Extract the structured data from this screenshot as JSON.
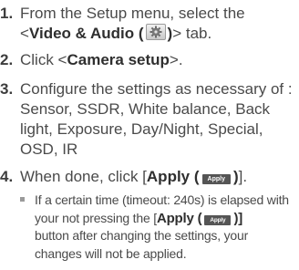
{
  "steps": [
    {
      "num": "1.",
      "line1": "From the Setup menu, select the",
      "pre": "<",
      "strong": "Video & Audio (",
      "strong_close": ")",
      "post": "> tab.",
      "icon": "gear-icon"
    },
    {
      "num": "2.",
      "pre": "Click <",
      "strong": "Camera setup",
      "post": ">."
    },
    {
      "num": "3.",
      "line1": "Configure the settings as necessary of :",
      "line2": "Sensor, SSDR, White balance, Back",
      "line3": "light, Exposure, Day/Night, Special,",
      "line4": "OSD, IR"
    },
    {
      "num": "4.",
      "pre": "When done, click [",
      "strong": "Apply (",
      "button_label": "Apply",
      "strong_close": ")",
      "post": "]."
    }
  ],
  "note": {
    "line1": "If a certain time (timeout: 240s) is elapsed with",
    "line2_pre": "your not pressing the [",
    "line2_strong": "Apply (",
    "button_label": "Apply",
    "line2_strong_close": ")",
    "line2_post": "]",
    "line3": "button after changing the settings, your",
    "line4": "changes will not be applied."
  }
}
